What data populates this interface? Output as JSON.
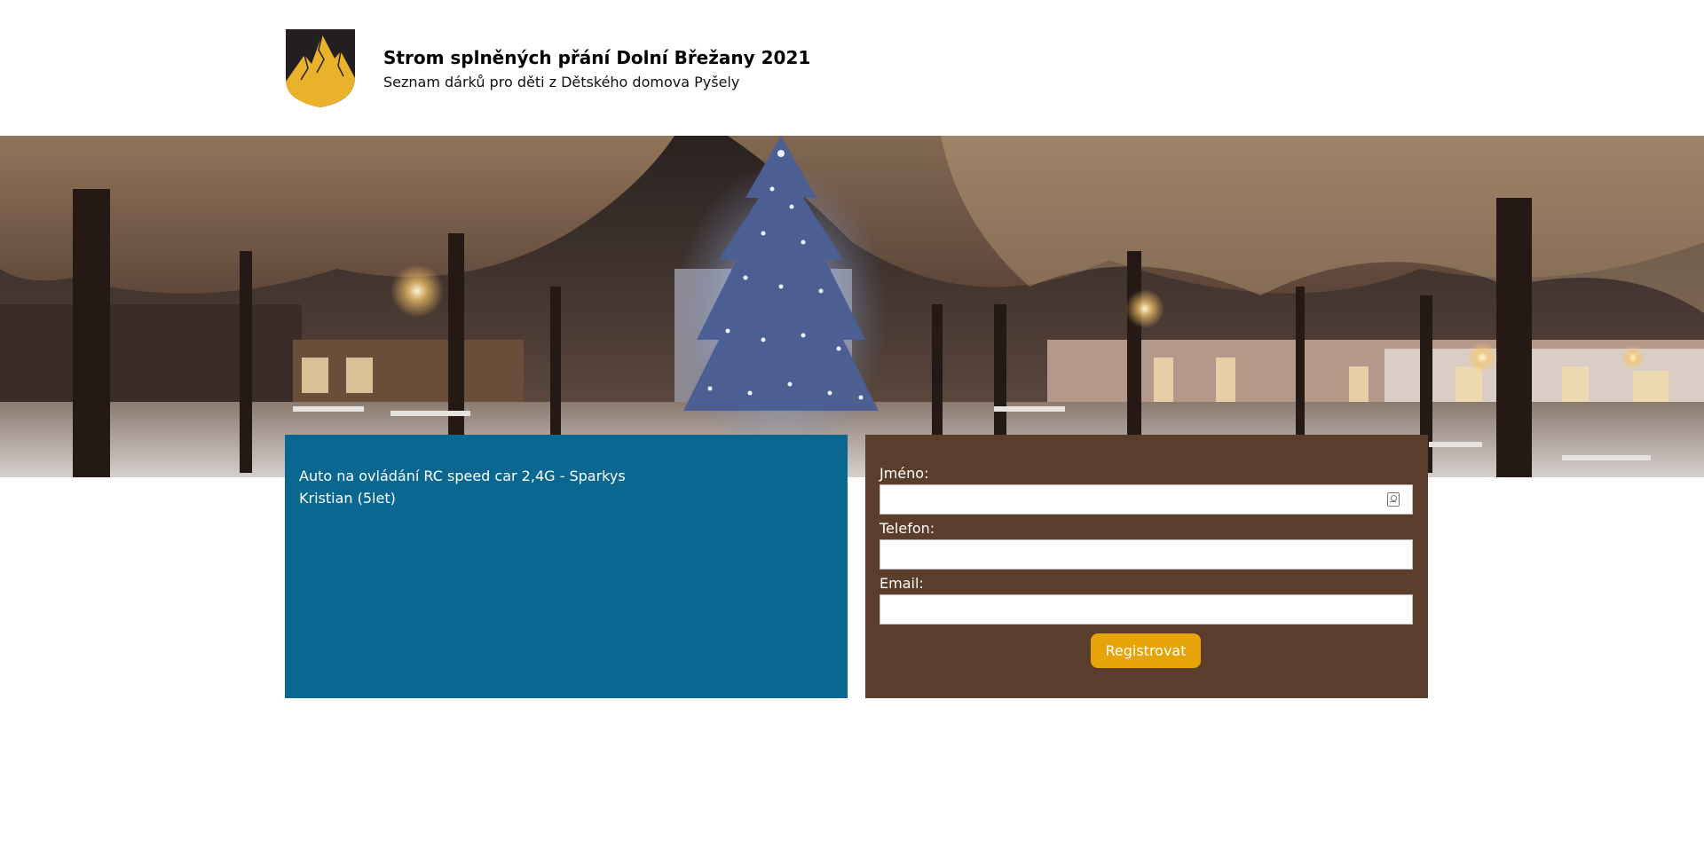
{
  "header": {
    "title": "Strom splněných přání Dolní Břežany 2021",
    "subtitle": "Seznam dárků pro děti z Dětského domova Pyšely"
  },
  "wish": {
    "item": "Auto na ovládání RC speed car 2,4G - Sparkys",
    "child": "Kristian (5let)"
  },
  "form": {
    "name_label": "Jméno:",
    "phone_label": "Telefon:",
    "email_label": "Email:",
    "submit_label": "Registrovat",
    "name_value": "",
    "phone_value": "",
    "email_value": ""
  },
  "icons": {
    "logo": "coat-of-arms-mountain",
    "autofill": "contact-card-icon"
  },
  "colors": {
    "wish_bg": "#0a6790",
    "form_bg": "#5a3e2b",
    "button": "#e6a408",
    "logo_gold": "#eab22a",
    "logo_dark": "#231f20"
  }
}
